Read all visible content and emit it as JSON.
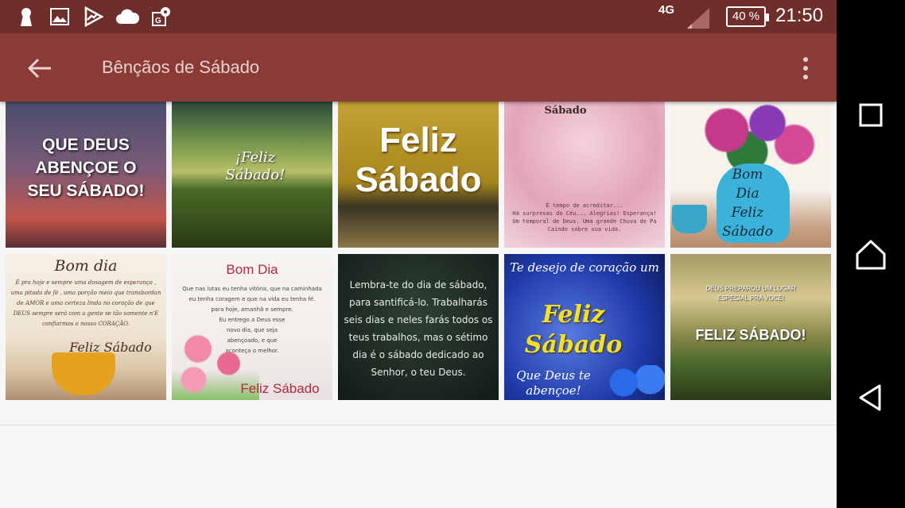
{
  "status_bar": {
    "network": "4G",
    "battery": "40 %",
    "time": "21:50",
    "icons": [
      "keyhole-icon",
      "image-icon",
      "play-store-icon",
      "cloud-icon",
      "maps-icon"
    ]
  },
  "app_bar": {
    "title": "Bênçãos de Sábado",
    "back_icon": "arrow-left-icon",
    "menu_icon": "more-vert-icon"
  },
  "colors": {
    "status_bar": "#6e2f2b",
    "app_bar": "#8b3a35",
    "title_text": "#e8d2cf",
    "background": "#f6f6f6"
  },
  "grid": {
    "tiles": [
      {
        "text": "QUE DEUS\nABENÇOE O\nSEU SÁBADO!"
      },
      {
        "text": "¡Feliz\nSábado!"
      },
      {
        "text": "Feliz\nSábado"
      },
      {
        "text": "Sábado",
        "sub": "É tempo de acreditar...\nHá surpresas do Céu... Alegrias! Esperança!\nUm temporal de Deus. Uma grande Chuva de Pa\nCaindo sobre sua vida."
      },
      {
        "text": "Bom\nDia\nFeliz\nSábado"
      },
      {
        "text": "Bom dia",
        "sub": "É pra hoje e sempre uma dosagem de esperança ,\numa pitada de fé , uma porção meio que transbordan\nde AMOR e uma certeza linda no coração de que\nDEUS sempre será com a gente se tão somente n'E\nconfiarmos o nosso CORAÇÃO.",
        "footer": "Feliz Sábado"
      },
      {
        "text": "Bom Dia",
        "sub": "Que nas lutas eu tenha vitória, que na caminhada\neu tenha coragem e que na vida eu tenha fé.\npara hoje, amanhã e sempre.\nEu entrego a Deus esse\nnovo dia, que seja\nabençoado, e que\naconteça o melhor.",
        "footer": "Feliz Sábado"
      },
      {
        "text": "Lembra-te do dia de sábado,\npara santificá-lo. Trabalharás\nseis dias e neles farás todos os\nteus trabalhos, mas o sétimo\ndia é o sábado dedicado ao\nSenhor, o teu Deus."
      },
      {
        "text": "Feliz\nSábado",
        "sub": "Te desejo de coração um",
        "footer": "Que Deus te\nabençoe!"
      },
      {
        "text": "FELIZ SÁBADO!",
        "sub": "DEUS PREPAROU UM LUGAR\nESPECIAL PRA VOCÊ!"
      }
    ]
  },
  "nav_bar": {
    "icons": [
      "recents-icon",
      "home-icon",
      "back-triangle-icon"
    ]
  }
}
